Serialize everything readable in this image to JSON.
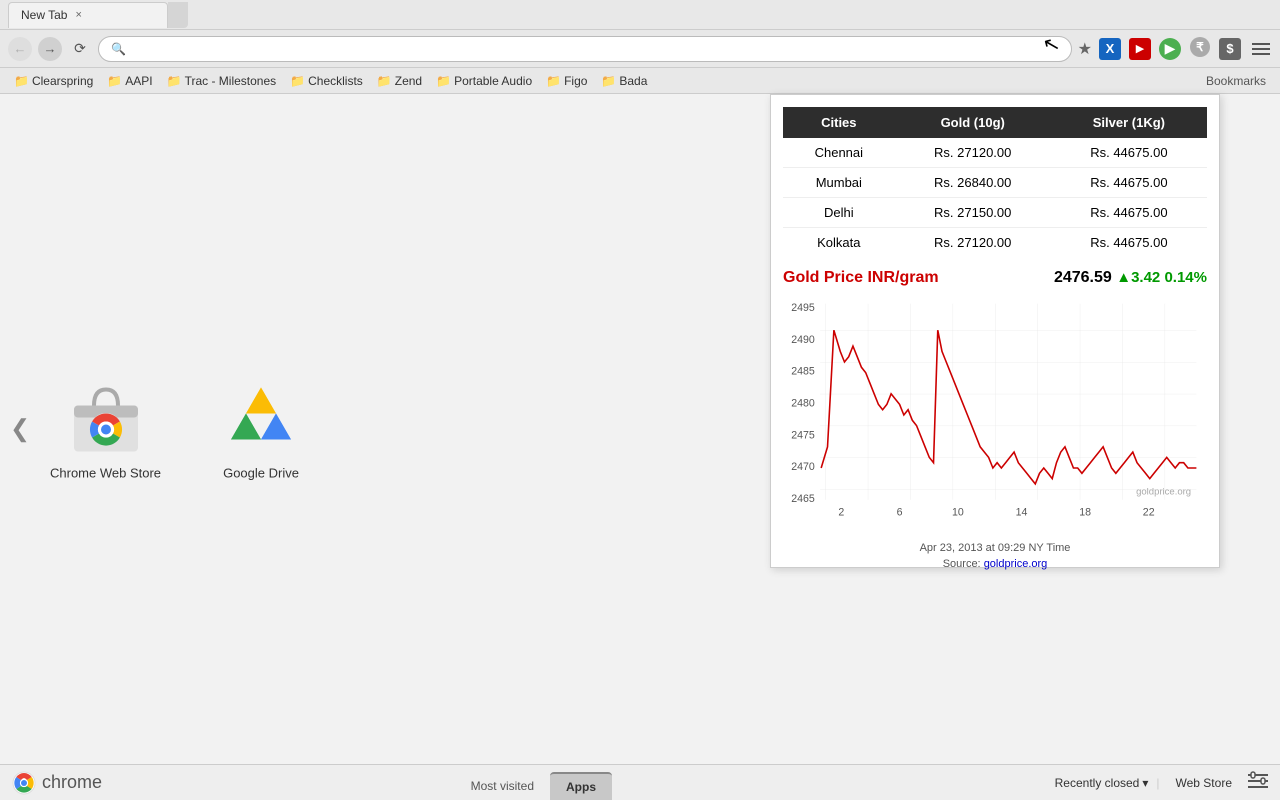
{
  "tab": {
    "title": "New Tab",
    "close_label": "×"
  },
  "address_bar": {
    "url": "",
    "placeholder": ""
  },
  "bookmarks": {
    "items": [
      {
        "label": "Clearspring",
        "icon": "📁"
      },
      {
        "label": "AAPI",
        "icon": "📁"
      },
      {
        "label": "Trac - Milestones",
        "icon": "📁"
      },
      {
        "label": "Checklists",
        "icon": "📁"
      },
      {
        "label": "Zend",
        "icon": "📁"
      },
      {
        "label": "Portable Audio",
        "icon": "📁"
      },
      {
        "label": "Figo",
        "icon": "📁"
      },
      {
        "label": "Bada",
        "icon": "📁"
      }
    ],
    "right_label": "Bookmarks"
  },
  "apps": [
    {
      "label": "Chrome Web Store"
    },
    {
      "label": "Google Drive"
    }
  ],
  "gold_widget": {
    "table_headers": [
      "Cities",
      "Gold (10g)",
      "Silver (1Kg)"
    ],
    "rows": [
      {
        "city": "Chennai",
        "gold": "Rs. 27120.00",
        "silver": "Rs. 44675.00"
      },
      {
        "city": "Mumbai",
        "gold": "Rs. 26840.00",
        "silver": "Rs. 44675.00"
      },
      {
        "city": "Delhi",
        "gold": "Rs. 27150.00",
        "silver": "Rs. 44675.00"
      },
      {
        "city": "Kolkata",
        "gold": "Rs. 27120.00",
        "silver": "Rs. 44675.00"
      }
    ],
    "chart_title": "Gold Price INR/gram",
    "price": "2476.59",
    "change": "▲3.42",
    "change_pct": "0.14%",
    "y_labels": [
      "2495",
      "2490",
      "2485",
      "2480",
      "2475",
      "2470",
      "2465"
    ],
    "x_labels": [
      "2",
      "6",
      "10",
      "14",
      "18",
      "22"
    ],
    "credit": "goldprice.org",
    "timestamp": "Apr 23, 2013 at 09:29 NY Time",
    "source_label": "Source:",
    "source_url": "goldprice.org"
  },
  "bottom_bar": {
    "logo_text": "chrome",
    "tabs": [
      "Most visited",
      "Apps"
    ],
    "active_tab": "Apps",
    "recently_closed": "Recently closed",
    "web_store": "Web Store",
    "settings_icon": "≡"
  }
}
